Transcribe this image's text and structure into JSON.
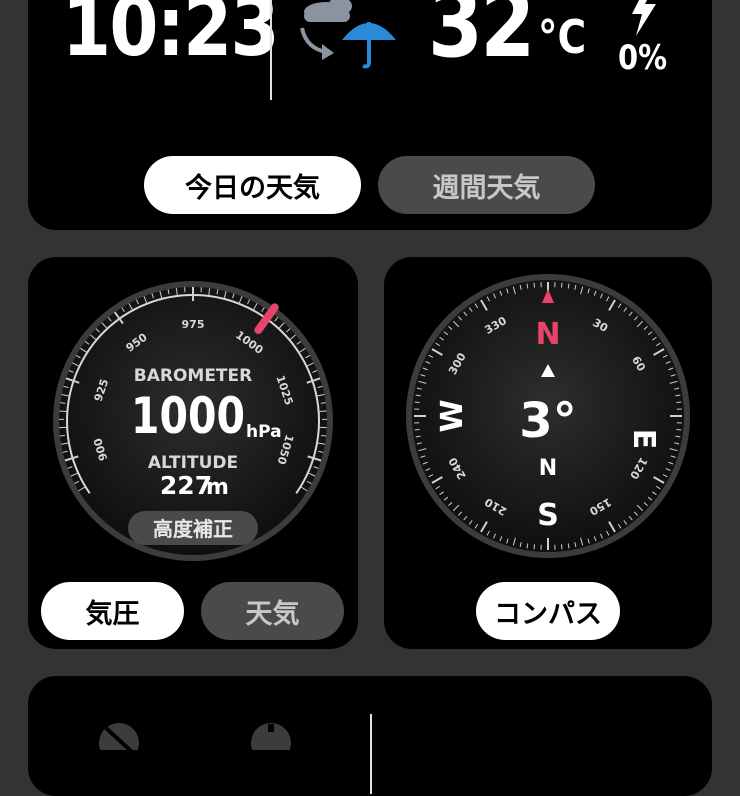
{
  "time": "10:23",
  "weather": {
    "temperature": "32",
    "unit": "°C",
    "precip": "0%",
    "icons": [
      "cloud-icon",
      "arrow-icon",
      "umbrella-icon",
      "lightning-icon"
    ]
  },
  "weather_tabs": [
    {
      "label": "今日の天気",
      "active": true
    },
    {
      "label": "週間天気",
      "active": false
    }
  ],
  "barometer": {
    "title": "BAROMETER",
    "value": "1000",
    "unit": "hPa",
    "altitude_label": "ALTITUDE",
    "altitude_value": "227",
    "altitude_unit": "m",
    "calibrate_label": "高度補正",
    "scale_labels": [
      "900",
      "925",
      "950",
      "975",
      "1000",
      "1025",
      "1050"
    ],
    "needle_value": 1000
  },
  "barometer_tabs": [
    {
      "label": "気圧",
      "active": true
    },
    {
      "label": "天気",
      "active": false
    }
  ],
  "compass": {
    "heading": "3°",
    "heading_dir": "N",
    "cardinals": {
      "N": "N",
      "E": "E",
      "S": "S",
      "W": "W"
    },
    "degree_labels": [
      "30",
      "60",
      "120",
      "150",
      "210",
      "240",
      "300",
      "330"
    ],
    "button_label": "コンパス"
  },
  "colors": {
    "background": "#333333",
    "card": "#000000",
    "accent_red": "#e8436a",
    "accent_blue": "#2b8ad8"
  }
}
